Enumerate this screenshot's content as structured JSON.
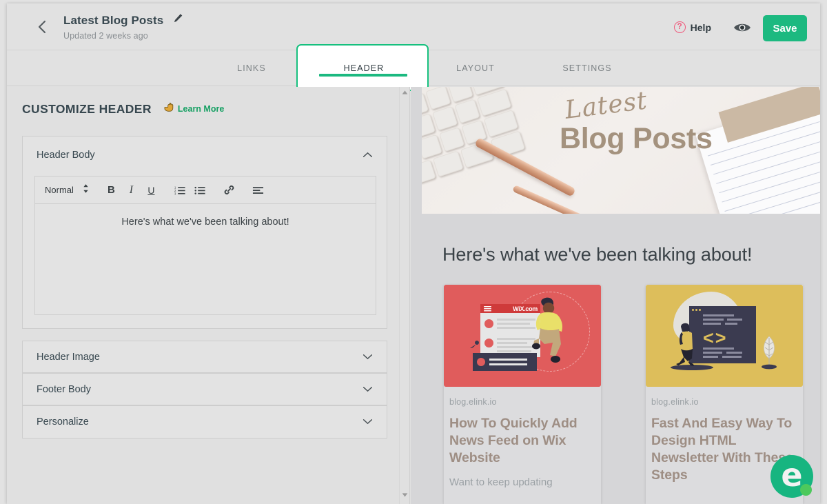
{
  "topbar": {
    "back_icon": "chevron-left-icon",
    "title": "Latest Blog Posts",
    "edit_icon": "pencil-icon",
    "subtitle": "Updated 2 weeks ago",
    "help_symbol": "?",
    "help_label": "Help",
    "preview_icon": "eye-icon",
    "save_label": "Save"
  },
  "tabs": [
    {
      "label": "LINKS",
      "active": false
    },
    {
      "label": "HEADER",
      "active": true
    },
    {
      "label": "LAYOUT",
      "active": false
    },
    {
      "label": "SETTINGS",
      "active": false
    }
  ],
  "editor": {
    "section_title": "CUSTOMIZE HEADER",
    "learn_more_icon": "pointing-hand-icon",
    "learn_more_label": "Learn More",
    "sections": [
      {
        "label": "Header Body",
        "expanded": true,
        "chevron": "chevron-up-icon"
      },
      {
        "label": "Header Image",
        "expanded": false,
        "chevron": "chevron-down-icon"
      },
      {
        "label": "Footer Body",
        "expanded": false,
        "chevron": "chevron-down-icon"
      },
      {
        "label": "Personalize",
        "expanded": false,
        "chevron": "chevron-down-icon"
      }
    ],
    "rte": {
      "format_value": "Normal",
      "format_icon": "up-down-caret-icon",
      "tools": [
        {
          "name": "bold-button",
          "glyph": "B"
        },
        {
          "name": "italic-button",
          "glyph": "I"
        },
        {
          "name": "underline-button",
          "glyph": "U"
        },
        {
          "name": "ordered-list-button",
          "glyph": ""
        },
        {
          "name": "bullet-list-button",
          "glyph": ""
        },
        {
          "name": "link-button",
          "glyph": ""
        },
        {
          "name": "align-button",
          "glyph": ""
        }
      ],
      "content": "Here's what we've been talking about!"
    },
    "scrollbar": {
      "up_icon": "scroll-up-arrow-icon",
      "down_icon": "scroll-down-arrow-icon"
    }
  },
  "preview": {
    "banner": {
      "script_text": "Latest",
      "main_text": "Blog Posts"
    },
    "heading": "Here's what we've been talking about!",
    "cards": [
      {
        "domain": "blog.elink.io",
        "title": "How To Quickly Add News Feed on Wix Website",
        "description": "Want to keep updating",
        "image_alt": "wix-illustration",
        "accent_color": "#e05c5c",
        "image_label": "WiX.com"
      },
      {
        "domain": "blog.elink.io",
        "title": "Fast And Easy Way To Design HTML Newsletter With These Steps",
        "description": "",
        "image_alt": "code-window-illustration",
        "accent_color": "#ddbe5b",
        "image_label": "<>"
      }
    ],
    "brand_logo": {
      "name": "elink-logo",
      "letter": "e",
      "color": "#17b580"
    }
  }
}
